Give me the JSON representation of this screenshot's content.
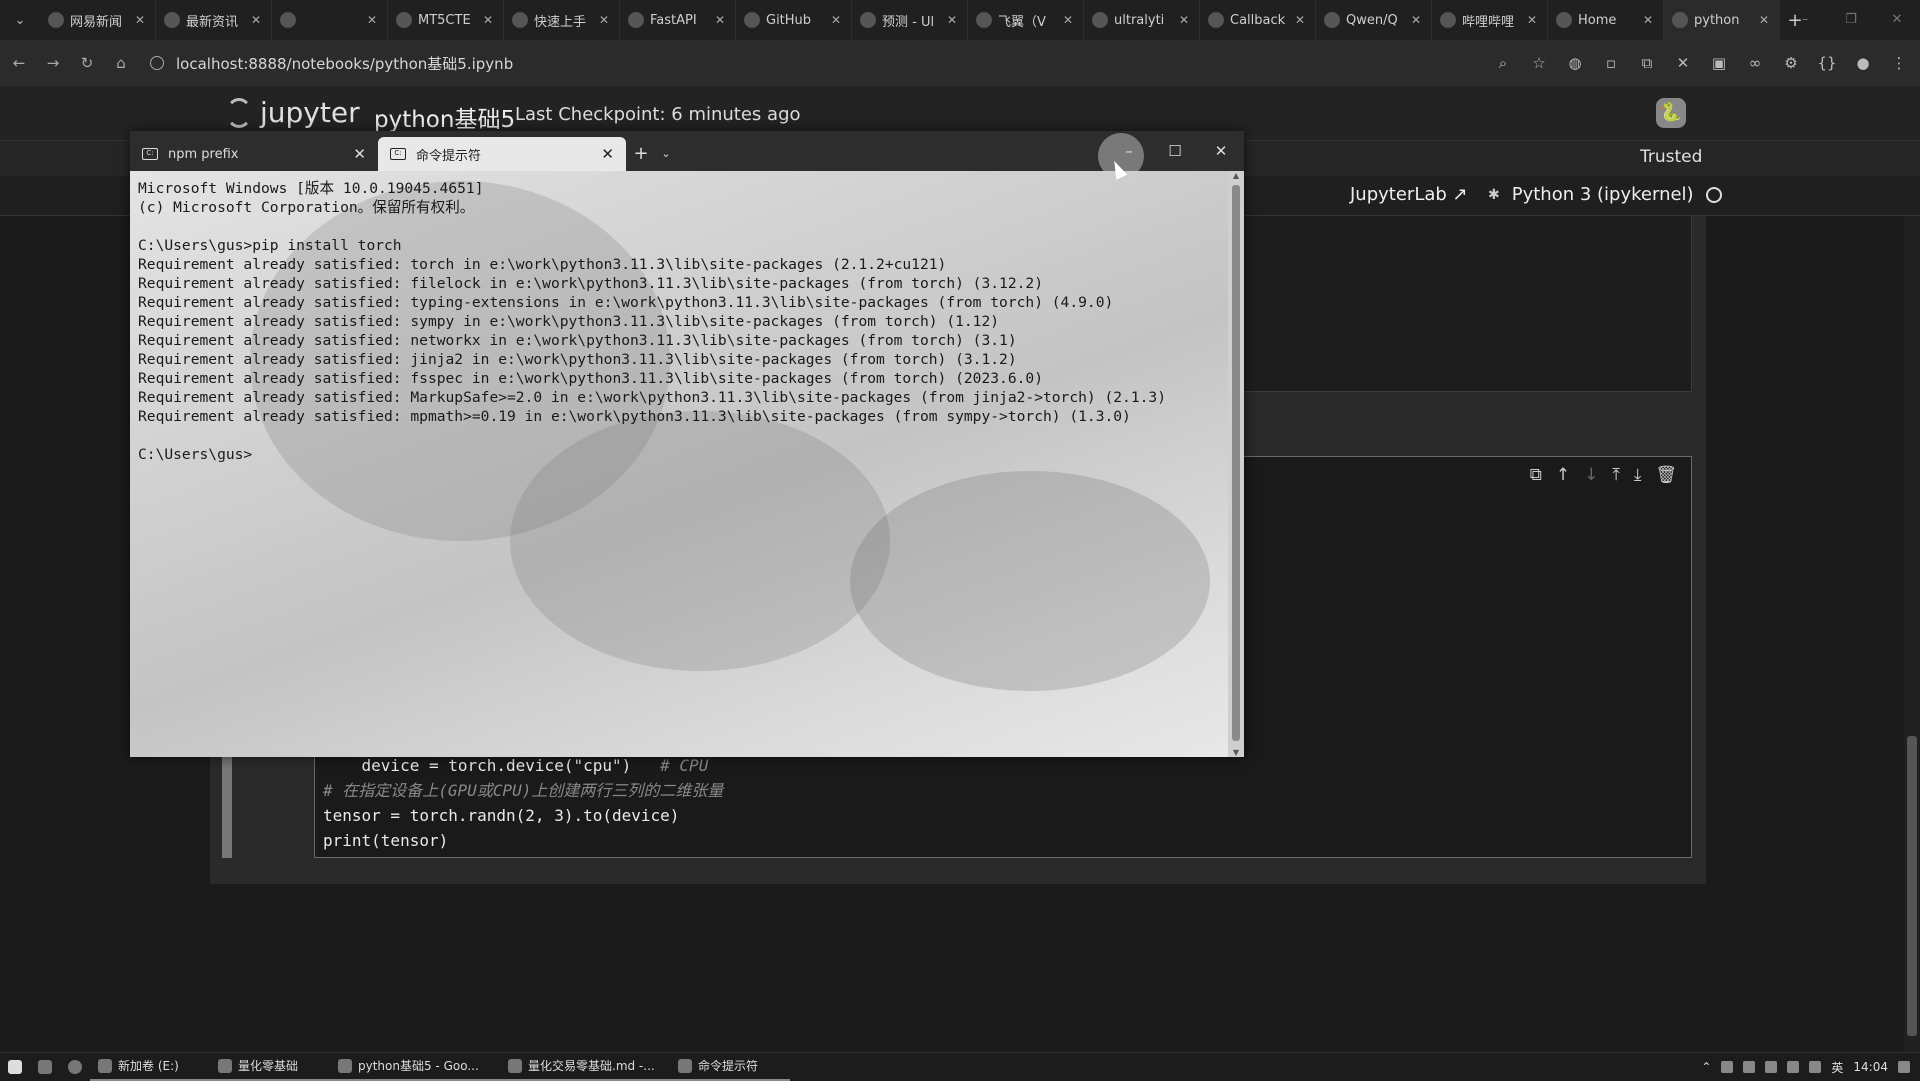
{
  "browser": {
    "tabs": [
      {
        "label": "网易新闻",
        "icon": "netease-icon"
      },
      {
        "label": "最新资讯",
        "icon": "news-icon"
      },
      {
        "label": "",
        "icon": "qi-icon"
      },
      {
        "label": "MT5CTE",
        "icon": "chatgpt-icon"
      },
      {
        "label": "快速上手",
        "icon": "doc-icon"
      },
      {
        "label": "FastAPI",
        "icon": "fastapi-icon"
      },
      {
        "label": "GitHub",
        "icon": "github-icon"
      },
      {
        "label": "预测 - Ul",
        "icon": "heart-icon"
      },
      {
        "label": "飞翼（V",
        "icon": "page-icon"
      },
      {
        "label": "ultralyti",
        "icon": "github-icon"
      },
      {
        "label": "Callback",
        "icon": "mail-icon"
      },
      {
        "label": "Qwen/Q",
        "icon": "github-icon"
      },
      {
        "label": "哔哩哔哩",
        "icon": "bilibili-icon"
      },
      {
        "label": "Home",
        "icon": "jupyter-icon"
      },
      {
        "label": "python",
        "icon": "jupyter-icon"
      }
    ],
    "url": "localhost:8888/notebooks/python基础5.ipynb"
  },
  "jupyter": {
    "logo_text": "jupyter",
    "notebook_title": "python基础5",
    "checkpoint": "Last Checkpoint: 6 minutes ago",
    "trusted": "Trusted",
    "jupyterlab": "JupyterLab",
    "kernel": "Python 3 (ipykernel)",
    "code_lines": [
      {
        "text": "    device = torch.device(\"cpu\")   ",
        "comment": "# CPU"
      },
      {
        "text": "",
        "comment": "# 在指定设备上(GPU或CPU)上创建两行三列的二维张量"
      },
      {
        "text": "tensor = torch.randn(2, 3).to(device)",
        "comment": ""
      },
      {
        "text": "print(tensor)",
        "comment": ""
      }
    ]
  },
  "terminal": {
    "tabs": [
      {
        "label": "npm prefix"
      },
      {
        "label": "命令提示符"
      }
    ],
    "output": "Microsoft Windows [版本 10.0.19045.4651]\n(c) Microsoft Corporation。保留所有权利。\n\nC:\\Users\\gus>pip install torch\nRequirement already satisfied: torch in e:\\work\\python3.11.3\\lib\\site-packages (2.1.2+cu121)\nRequirement already satisfied: filelock in e:\\work\\python3.11.3\\lib\\site-packages (from torch) (3.12.2)\nRequirement already satisfied: typing-extensions in e:\\work\\python3.11.3\\lib\\site-packages (from torch) (4.9.0)\nRequirement already satisfied: sympy in e:\\work\\python3.11.3\\lib\\site-packages (from torch) (1.12)\nRequirement already satisfied: networkx in e:\\work\\python3.11.3\\lib\\site-packages (from torch) (3.1)\nRequirement already satisfied: jinja2 in e:\\work\\python3.11.3\\lib\\site-packages (from torch) (3.1.2)\nRequirement already satisfied: fsspec in e:\\work\\python3.11.3\\lib\\site-packages (from torch) (2023.6.0)\nRequirement already satisfied: MarkupSafe>=2.0 in e:\\work\\python3.11.3\\lib\\site-packages (from jinja2->torch) (2.1.3)\nRequirement already satisfied: mpmath>=0.19 in e:\\work\\python3.11.3\\lib\\site-packages (from sympy->torch) (1.3.0)\n\nC:\\Users\\gus>"
  },
  "taskbar": {
    "items": [
      {
        "label": "新加卷 (E:)"
      },
      {
        "label": "量化零基础"
      },
      {
        "label": "python基础5 - Goo..."
      },
      {
        "label": "量化交易零基础.md -..."
      },
      {
        "label": "命令提示符"
      }
    ],
    "ime": "英",
    "time": "14:04"
  }
}
